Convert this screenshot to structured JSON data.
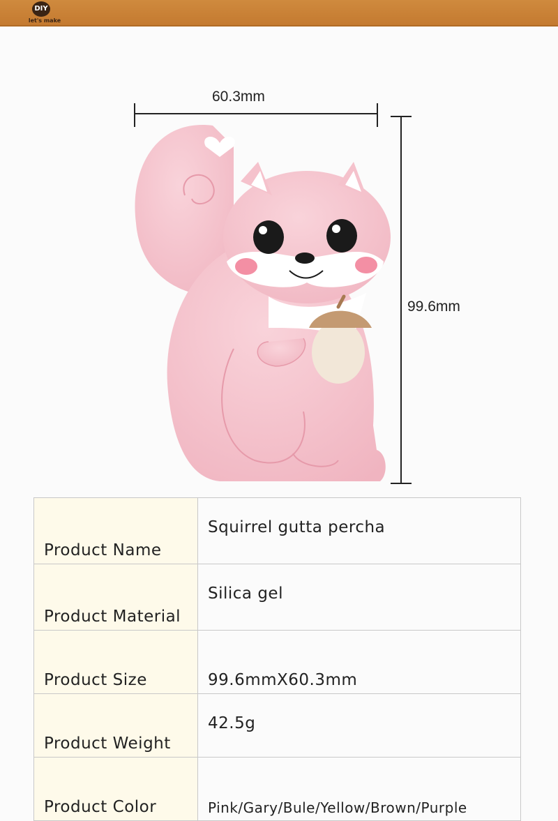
{
  "header": {
    "logo_badge": "DIY",
    "logo_text": "let's make"
  },
  "dimensions": {
    "width_label": "60.3mm",
    "height_label": "99.6mm"
  },
  "product_image": {
    "subject": "pink squirrel teether holding acorn",
    "color": "#f5c2cc"
  },
  "specs": [
    {
      "label": "Product Name",
      "value": "Squirrel gutta percha"
    },
    {
      "label": "Product Material",
      "value": "Silica gel"
    },
    {
      "label": "Product Size",
      "value": "99.6mmX60.3mm"
    },
    {
      "label": "Product Weight",
      "value": "42.5g"
    },
    {
      "label": "Product Color",
      "value": "Pink/Gary/Bule/Yellow/Brown/Purple"
    }
  ]
}
